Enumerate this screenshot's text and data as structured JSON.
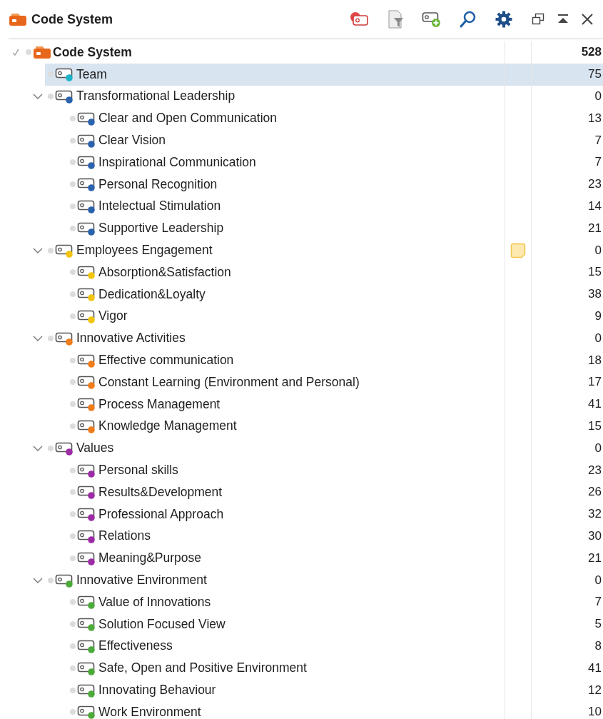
{
  "panel": {
    "title": "Code System"
  },
  "tree": {
    "label": "Code System",
    "count": "528",
    "checked": true,
    "expanded": true,
    "children": [
      {
        "label": "Team",
        "count": "75",
        "color": "#1bb3c8",
        "selected": true,
        "memo": false
      },
      {
        "label": "Transformational Leadership",
        "count": "0",
        "color": "#2a62ad",
        "selected": false,
        "memo": false,
        "expanded": true,
        "children": [
          {
            "label": "Clear and Open Communication",
            "count": "13",
            "color": "#2a62ad",
            "selected": false
          },
          {
            "label": "Clear Vision",
            "count": "7",
            "color": "#2a62ad",
            "selected": false
          },
          {
            "label": "Inspirational Communication",
            "count": "7",
            "color": "#2a62ad",
            "selected": false
          },
          {
            "label": "Personal Recognition",
            "count": "23",
            "color": "#2a62ad",
            "selected": false
          },
          {
            "label": "Intelectual Stimulation",
            "count": "14",
            "color": "#2a62ad",
            "selected": false
          },
          {
            "label": "Supportive Leadership",
            "count": "21",
            "color": "#2a62ad",
            "selected": false
          }
        ]
      },
      {
        "label": "Employees Engagement",
        "count": "0",
        "color": "#f2c40f",
        "selected": false,
        "memo": true,
        "expanded": true,
        "children": [
          {
            "label": "Absorption&Satisfaction",
            "count": "15",
            "color": "#f2c40f",
            "selected": false
          },
          {
            "label": "Dedication&Loyalty",
            "count": "38",
            "color": "#f2c40f",
            "selected": false
          },
          {
            "label": "Vigor",
            "count": "9",
            "color": "#f2c40f",
            "selected": false
          }
        ]
      },
      {
        "label": "Innovative Activities",
        "count": "0",
        "color": "#f07c1c",
        "selected": false,
        "memo": false,
        "expanded": true,
        "children": [
          {
            "label": "Effective communication",
            "count": "18",
            "color": "#f07c1c",
            "selected": false
          },
          {
            "label": "Constant Learning (Environment and Personal)",
            "count": "17",
            "color": "#f07c1c",
            "selected": false
          },
          {
            "label": "Process Management",
            "count": "41",
            "color": "#f07c1c",
            "selected": false
          },
          {
            "label": "Knowledge Management",
            "count": "15",
            "color": "#f07c1c",
            "selected": false
          }
        ]
      },
      {
        "label": "Values",
        "count": "0",
        "color": "#9c2ca6",
        "selected": false,
        "memo": false,
        "expanded": true,
        "children": [
          {
            "label": "Personal skills",
            "count": "23",
            "color": "#9c2ca6",
            "selected": false
          },
          {
            "label": "Results&Development",
            "count": "26",
            "color": "#9c2ca6",
            "selected": false
          },
          {
            "label": "Professional Approach",
            "count": "32",
            "color": "#9c2ca6",
            "selected": false
          },
          {
            "label": "Relations",
            "count": "30",
            "color": "#9c2ca6",
            "selected": false
          },
          {
            "label": "Meaning&Purpose",
            "count": "21",
            "color": "#9c2ca6",
            "selected": false
          }
        ]
      },
      {
        "label": "Innovative Environment",
        "count": "0",
        "color": "#4caa3a",
        "selected": false,
        "memo": false,
        "expanded": true,
        "children": [
          {
            "label": "Value of Innovations",
            "count": "7",
            "color": "#4caa3a",
            "selected": false
          },
          {
            "label": "Solution Focused View",
            "count": "5",
            "color": "#4caa3a",
            "selected": false
          },
          {
            "label": "Effectiveness",
            "count": "8",
            "color": "#4caa3a",
            "selected": false
          },
          {
            "label": "Safe, Open and Positive Environment",
            "count": "41",
            "color": "#4caa3a",
            "selected": false
          },
          {
            "label": "Innovating Behaviour",
            "count": "12",
            "color": "#4caa3a",
            "selected": false
          },
          {
            "label": "Work Environment",
            "count": "10",
            "color": "#4caa3a",
            "selected": false
          }
        ]
      }
    ]
  }
}
